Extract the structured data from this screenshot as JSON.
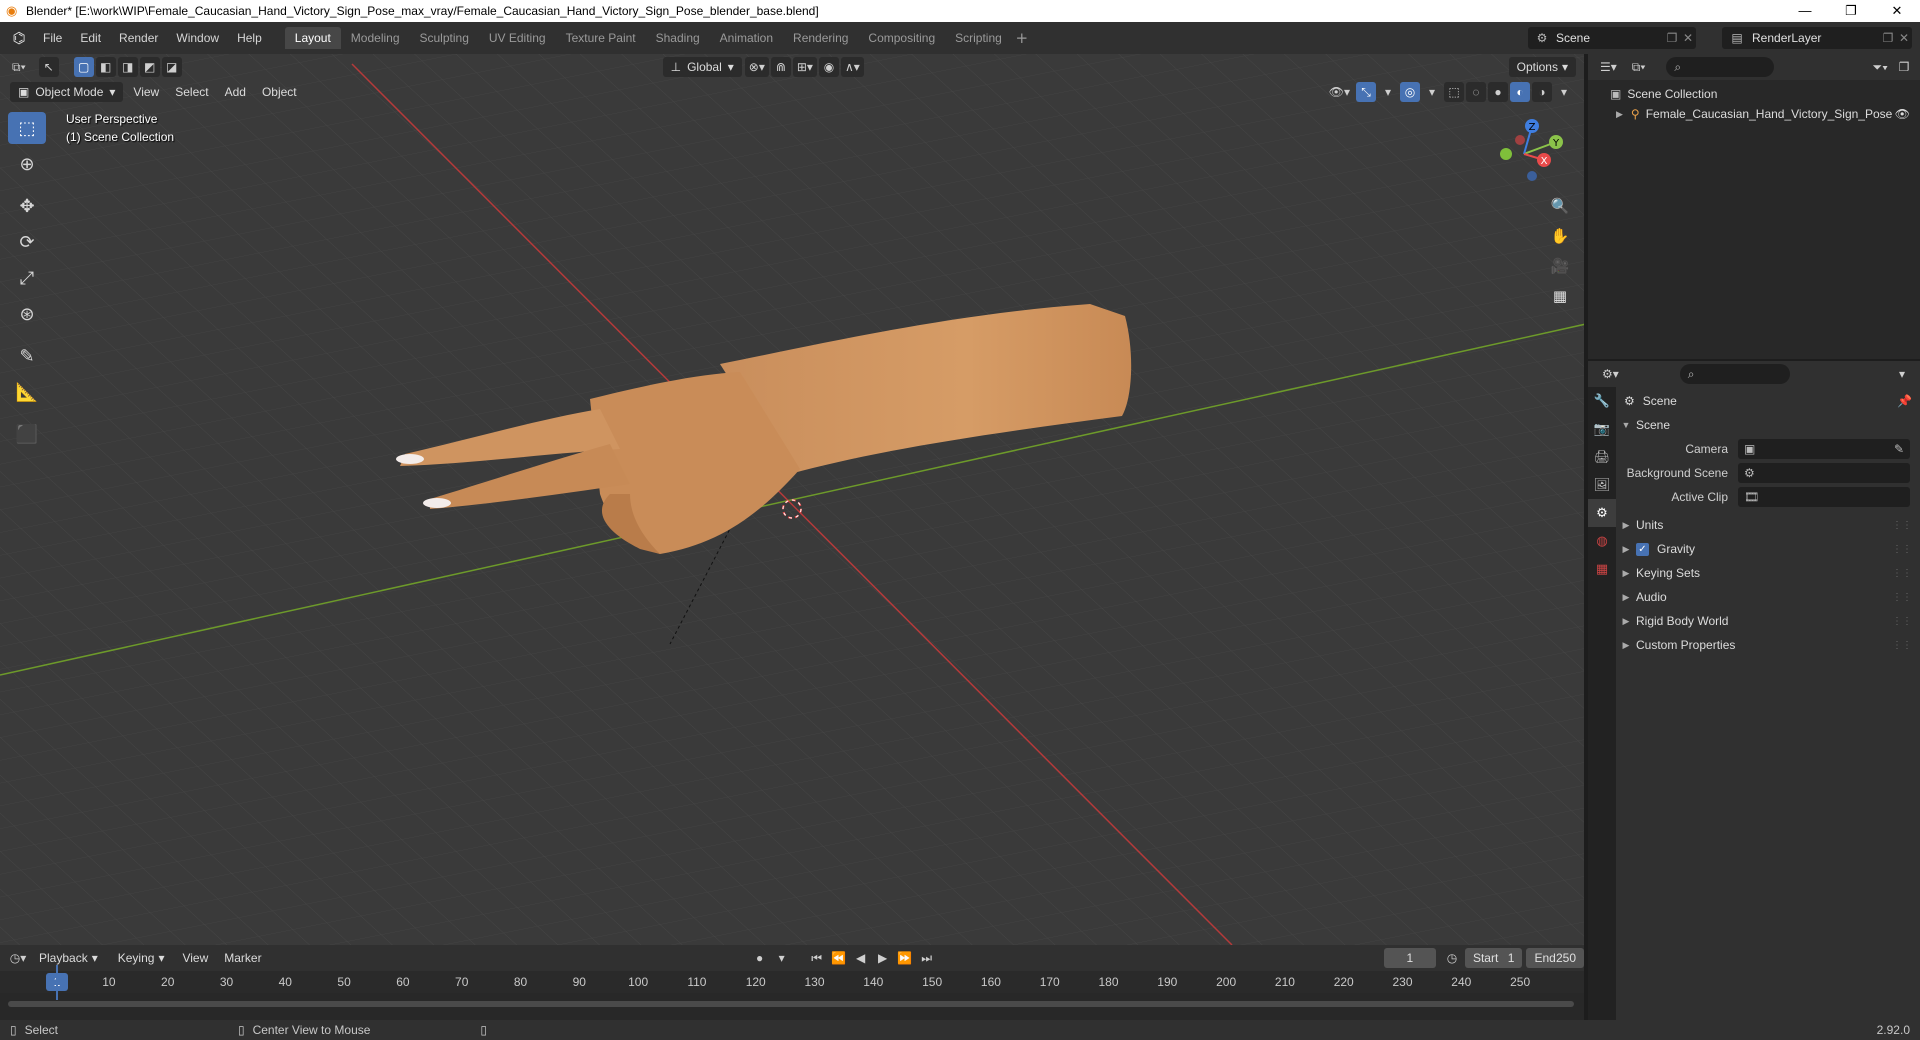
{
  "window": {
    "title": "Blender* [E:\\work\\WIP\\Female_Caucasian_Hand_Victory_Sign_Pose_max_vray/Female_Caucasian_Hand_Victory_Sign_Pose_blender_base.blend]",
    "minimize": "—",
    "maximize": "❐",
    "close": "✕"
  },
  "menu": {
    "items": [
      "File",
      "Edit",
      "Render",
      "Window",
      "Help"
    ]
  },
  "workspaces": {
    "tabs": [
      "Layout",
      "Modeling",
      "Sculpting",
      "UV Editing",
      "Texture Paint",
      "Shading",
      "Animation",
      "Rendering",
      "Compositing",
      "Scripting"
    ],
    "active": "Layout",
    "add": "+"
  },
  "scene_selector": {
    "label": "Scene"
  },
  "layer_selector": {
    "label": "RenderLayer"
  },
  "viewport": {
    "mode": "Object Mode",
    "menus": [
      "View",
      "Select",
      "Add",
      "Object"
    ],
    "orientation": "Global",
    "options": "Options",
    "info_line1": "User Perspective",
    "info_line2": "(1) Scene Collection",
    "axes": {
      "x": "X",
      "y": "Y",
      "z": "Z"
    }
  },
  "timeline": {
    "menus": [
      "Playback",
      "Keying",
      "View",
      "Marker"
    ],
    "current_frame": "1",
    "start_label": "Start",
    "start_value": "1",
    "end_label": "End",
    "end_value": "250",
    "ticks": [
      "1",
      "10",
      "20",
      "30",
      "40",
      "50",
      "60",
      "70",
      "80",
      "90",
      "100",
      "110",
      "120",
      "130",
      "140",
      "150",
      "160",
      "170",
      "180",
      "190",
      "200",
      "210",
      "220",
      "230",
      "240",
      "250"
    ]
  },
  "statusbar": {
    "select": "Select",
    "center_view": "Center View to Mouse",
    "version": "2.92.0"
  },
  "outliner": {
    "root": "Scene Collection",
    "object": "Female_Caucasian_Hand_Victory_Sign_Pose"
  },
  "properties": {
    "context": "Scene",
    "section": "Scene",
    "camera_label": "Camera",
    "background_scene_label": "Background Scene",
    "active_clip_label": "Active Clip",
    "panels": [
      "Units",
      "Gravity",
      "Keying Sets",
      "Audio",
      "Rigid Body World",
      "Custom Properties"
    ]
  }
}
